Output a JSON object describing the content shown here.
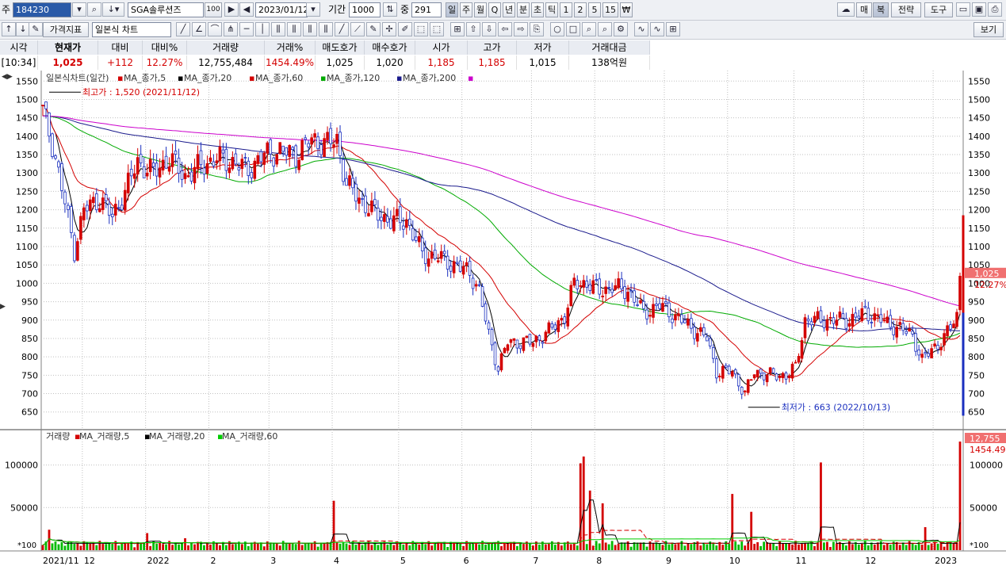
{
  "toolbar1": {
    "code_prefix": "주",
    "stock_code": "184230",
    "stock_name": "SGA솔루션즈",
    "name_badge": "100",
    "date": "2023/01/12",
    "period_label": "기간",
    "period_value": "1000",
    "count_label": "중",
    "count_value": "291",
    "interval_buttons": [
      "일",
      "주",
      "월",
      "Q",
      "년",
      "분",
      "초",
      "틱",
      "1",
      "2",
      "5",
      "15",
      "₩"
    ],
    "right_buttons": [
      "매",
      "복",
      "전략",
      "도구"
    ]
  },
  "toolbar2": {
    "indicator_button": "가격지표",
    "chart_type_select": "일본식 차트",
    "view_button": "보기"
  },
  "quote": {
    "headers": [
      "시각",
      "현재가",
      "대비",
      "대비%",
      "거래량",
      "거래%",
      "매도호가",
      "매수호가",
      "시가",
      "고가",
      "저가",
      "거래대금"
    ],
    "values": [
      "[10:34]",
      "1,025",
      "+112",
      "12.27%",
      "12,755,484",
      "1454.49%",
      "1,025",
      "1,020",
      "1,185",
      "1,185",
      "1,015",
      "138억원"
    ]
  },
  "chart_data": [
    {
      "type": "candlestick",
      "title": "일본식차트(일간)",
      "legend": [
        "MA_종가,5",
        "MA_종가,20",
        "MA_종가,60",
        "MA_종가,120",
        "MA_종가,200"
      ],
      "legend_colors": [
        "#d40000",
        "#000000",
        "#d40000",
        "#00aa00",
        "#1a1a8c",
        "#cc00cc"
      ],
      "ylim": [
        630,
        1570
      ],
      "yticks": [
        650,
        700,
        750,
        800,
        850,
        900,
        950,
        1000,
        1050,
        1100,
        1150,
        1200,
        1250,
        1300,
        1350,
        1400,
        1450,
        1500,
        1550
      ],
      "xlabels": [
        {
          "label": "2021/11",
          "day": 0
        },
        {
          "label": "12",
          "day": 13
        },
        {
          "label": "2022",
          "day": 33
        },
        {
          "label": "2",
          "day": 53
        },
        {
          "label": "3",
          "day": 72
        },
        {
          "label": "4",
          "day": 92
        },
        {
          "label": "5",
          "day": 113
        },
        {
          "label": "6",
          "day": 133
        },
        {
          "label": "7",
          "day": 155
        },
        {
          "label": "8",
          "day": 175
        },
        {
          "label": "9",
          "day": 197
        },
        {
          "label": "10",
          "day": 217
        },
        {
          "label": "11",
          "day": 238
        },
        {
          "label": "12",
          "day": 260
        },
        {
          "label": "2023",
          "day": 282
        }
      ],
      "total_days": 291,
      "closes_anchor": [
        [
          0,
          1470
        ],
        [
          3,
          1380
        ],
        [
          6,
          1260
        ],
        [
          10,
          1090
        ],
        [
          13,
          1200
        ],
        [
          18,
          1230
        ],
        [
          22,
          1180
        ],
        [
          26,
          1250
        ],
        [
          30,
          1330
        ],
        [
          35,
          1300
        ],
        [
          40,
          1340
        ],
        [
          45,
          1290
        ],
        [
          50,
          1320
        ],
        [
          55,
          1340
        ],
        [
          60,
          1330
        ],
        [
          65,
          1310
        ],
        [
          70,
          1350
        ],
        [
          75,
          1360
        ],
        [
          80,
          1350
        ],
        [
          85,
          1390
        ],
        [
          90,
          1380
        ],
        [
          93,
          1390
        ],
        [
          96,
          1270
        ],
        [
          100,
          1230
        ],
        [
          105,
          1190
        ],
        [
          110,
          1170
        ],
        [
          115,
          1170
        ],
        [
          120,
          1080
        ],
        [
          125,
          1070
        ],
        [
          130,
          1050
        ],
        [
          135,
          1030
        ],
        [
          138,
          980
        ],
        [
          141,
          860
        ],
        [
          144,
          770
        ],
        [
          147,
          840
        ],
        [
          150,
          840
        ],
        [
          155,
          840
        ],
        [
          160,
          870
        ],
        [
          165,
          910
        ],
        [
          168,
          1000
        ],
        [
          172,
          1000
        ],
        [
          176,
          980
        ],
        [
          180,
          990
        ],
        [
          185,
          980
        ],
        [
          190,
          920
        ],
        [
          195,
          940
        ],
        [
          200,
          910
        ],
        [
          205,
          880
        ],
        [
          210,
          850
        ],
        [
          213,
          760
        ],
        [
          218,
          760
        ],
        [
          222,
          700
        ],
        [
          225,
          760
        ],
        [
          230,
          750
        ],
        [
          235,
          750
        ],
        [
          238,
          770
        ],
        [
          241,
          900
        ],
        [
          245,
          900
        ],
        [
          250,
          900
        ],
        [
          255,
          900
        ],
        [
          260,
          920
        ],
        [
          265,
          900
        ],
        [
          270,
          880
        ],
        [
          275,
          860
        ],
        [
          278,
          790
        ],
        [
          281,
          820
        ],
        [
          285,
          850
        ],
        [
          289,
          913
        ],
        [
          290,
          1025
        ]
      ],
      "annotations": [
        {
          "text": "최고가 : 1,520 (2021/11/12)",
          "value": 1520,
          "day": 2
        },
        {
          "text": "최저가 : 663 (2022/10/13)",
          "value": 663,
          "day": 223
        }
      ],
      "current_price": {
        "value": "1,025",
        "change_pct": "12.27%"
      }
    },
    {
      "type": "bar",
      "title": "거래량",
      "legend": [
        "MA_거래량,5",
        "MA_거래량,20",
        "MA_거래량,60"
      ],
      "ylim": [
        0,
        135000
      ],
      "yticks": [
        50000,
        100000
      ],
      "ytick_labels": [
        "50000",
        "100000"
      ],
      "unit_label": "*100",
      "spikes": [
        [
          2,
          24000
        ],
        [
          33,
          20000
        ],
        [
          45,
          14000
        ],
        [
          92,
          58000
        ],
        [
          170,
          102000
        ],
        [
          171,
          110000
        ],
        [
          173,
          70000
        ],
        [
          177,
          55000
        ],
        [
          218,
          66000
        ],
        [
          224,
          45000
        ],
        [
          246,
          103000
        ],
        [
          279,
          27000
        ],
        [
          290,
          127555
        ]
      ],
      "current_volume": {
        "value": "12,755",
        "change_pct": "1454.49%"
      }
    }
  ]
}
